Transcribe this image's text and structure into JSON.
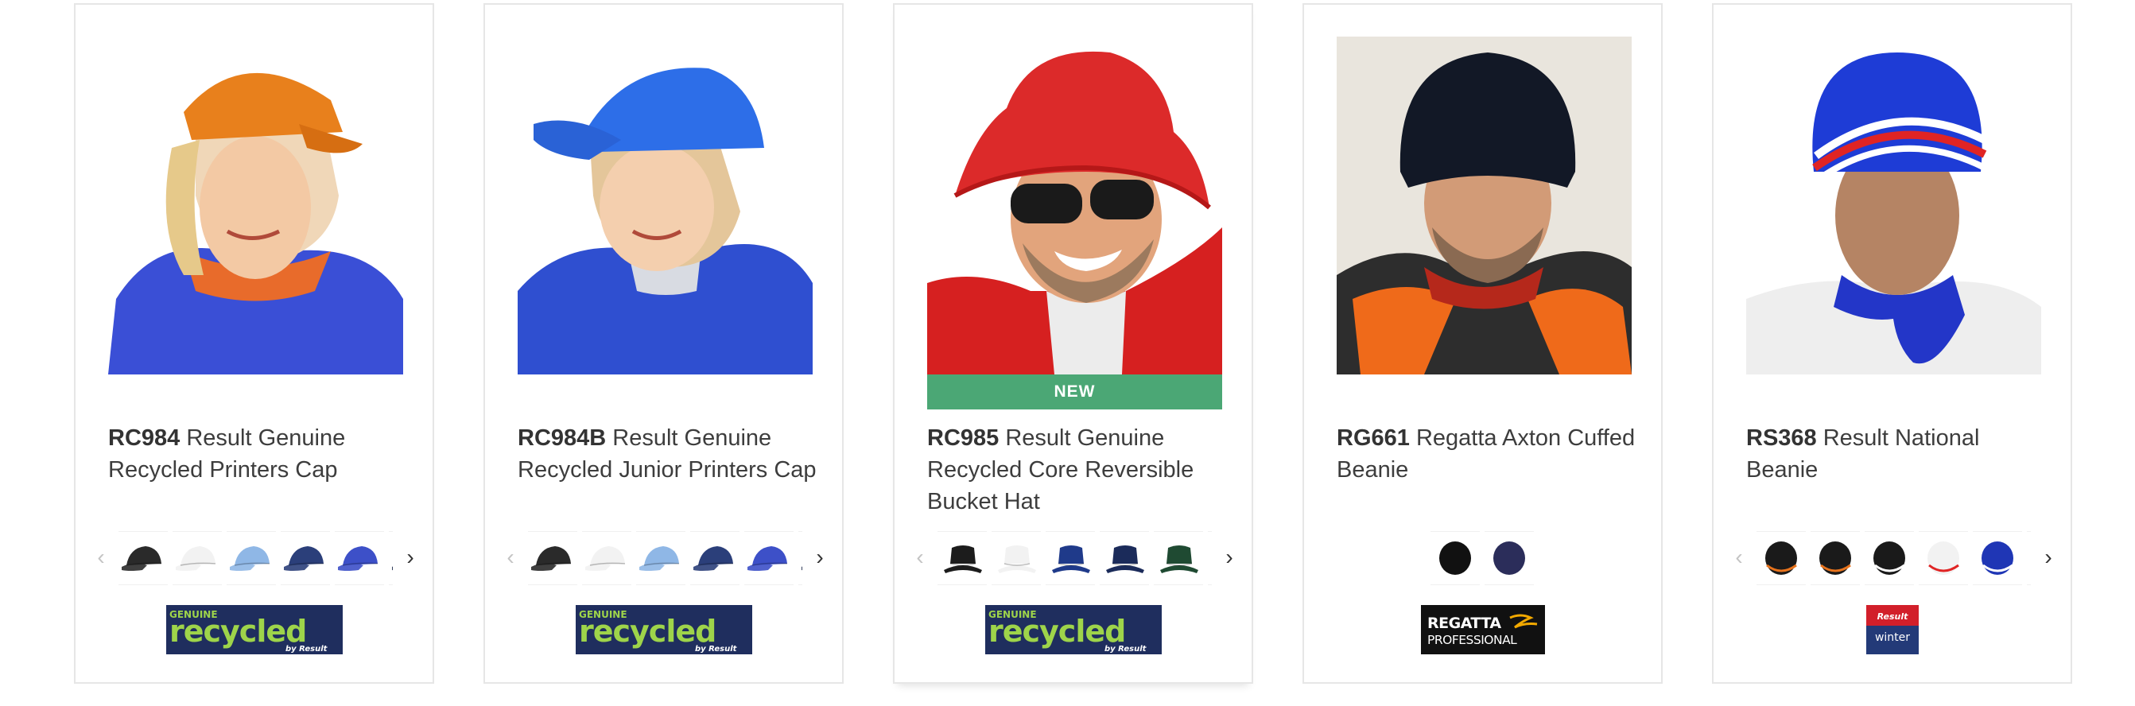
{
  "products": [
    {
      "code": "RC984",
      "name": "Result Genuine Recycled Printers Cap",
      "badge": "",
      "swatch_colors": [
        "#2a2a2a",
        "#f2f2f2",
        "#8fb7e6",
        "#2b3f7a",
        "#3d50c8",
        "#1e2a4a"
      ],
      "has_arrows": true,
      "brand": "recycled",
      "brand_line1": "GENUINE",
      "brand_line2": "recycled",
      "brand_line3": "by Result"
    },
    {
      "code": "RC984B",
      "name": "Result Genuine Recycled Junior Printers Cap",
      "badge": "",
      "swatch_colors": [
        "#2a2a2a",
        "#f2f2f2",
        "#8fb7e6",
        "#2b3f7a",
        "#3d50c8",
        "#1e2a4a"
      ],
      "has_arrows": true,
      "brand": "recycled",
      "brand_line1": "GENUINE",
      "brand_line2": "recycled",
      "brand_line3": "by Result"
    },
    {
      "code": "RC985",
      "name": "Result Genuine Recycled Core Reversible Bucket Hat",
      "badge": "NEW",
      "swatch_colors": [
        "#1c1c1c",
        "#f2f2f2",
        "#1f3a8a",
        "#1b2b5a",
        "#1f4a32",
        "#2a2a2a"
      ],
      "has_arrows": true,
      "brand": "recycled",
      "brand_line1": "GENUINE",
      "brand_line2": "recycled",
      "brand_line3": "by Result"
    },
    {
      "code": "RG661",
      "name": "Regatta Axton Cuffed Beanie",
      "badge": "",
      "swatch_colors": [
        "#111111",
        "#2b2d5a"
      ],
      "has_arrows": false,
      "brand": "regatta",
      "brand_line1": "REGATTA",
      "brand_line2": "PROFESSIONAL",
      "brand_line3": ""
    },
    {
      "code": "RS368",
      "name": "Result National Beanie",
      "badge": "",
      "swatch_colors": [
        "#1a1a1a",
        "#1a1a1a",
        "#1a1a1a",
        "#f2f2f2",
        "#1f36b5",
        "#1f36b5"
      ],
      "swatch_stripes": [
        "#e8731c",
        "#e8731c",
        "#ffffff",
        "#e02424",
        "#ffffff",
        "#e02424"
      ],
      "has_arrows": true,
      "brand": "winter",
      "brand_line1": "Result",
      "brand_line2": "winter",
      "brand_line3": ""
    }
  ],
  "ui": {
    "prev_arrow": "‹",
    "next_arrow": "›"
  },
  "colors": {
    "badge_green": "#4ba775",
    "border": "#e6e6e6",
    "recycled_navy": "#1f2e5e",
    "recycled_green": "#9ed44a"
  }
}
